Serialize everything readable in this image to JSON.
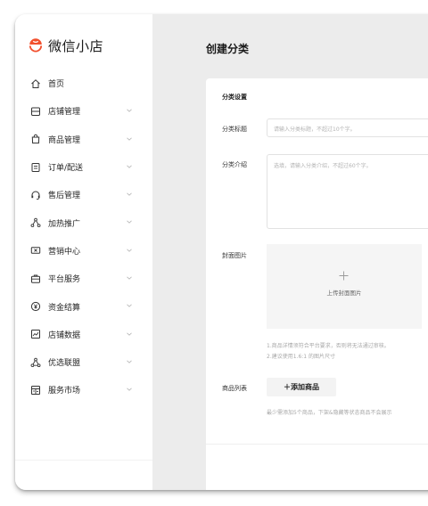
{
  "app": {
    "name": "微信小店",
    "brand_color": "#f2502e"
  },
  "sidebar": {
    "items": [
      {
        "label": "首页",
        "icon": "home-icon",
        "has_submenu": false
      },
      {
        "label": "店铺管理",
        "icon": "store-icon",
        "has_submenu": true
      },
      {
        "label": "商品管理",
        "icon": "shopping-bag-icon",
        "has_submenu": true
      },
      {
        "label": "订单/配送",
        "icon": "order-list-icon",
        "has_submenu": true
      },
      {
        "label": "售后管理",
        "icon": "headset-icon",
        "has_submenu": true
      },
      {
        "label": "加热推广",
        "icon": "share-nodes-icon",
        "has_submenu": true
      },
      {
        "label": "营销中心",
        "icon": "ticket-icon",
        "has_submenu": true
      },
      {
        "label": "平台服务",
        "icon": "briefcase-icon",
        "has_submenu": true
      },
      {
        "label": "资金结算",
        "icon": "yen-circle-icon",
        "has_submenu": true
      },
      {
        "label": "店铺数据",
        "icon": "chart-icon",
        "has_submenu": true
      },
      {
        "label": "优选联盟",
        "icon": "alliance-icon",
        "has_submenu": true
      },
      {
        "label": "服务市场",
        "icon": "market-icon",
        "has_submenu": true
      }
    ]
  },
  "page": {
    "title": "创建分类"
  },
  "form": {
    "section_title": "分类设置",
    "name_label": "分类标题",
    "name_placeholder": "请输入分类标题，不超过10个字。",
    "desc_label": "分类介绍",
    "desc_placeholder": "选填，请输入分类介绍，不超过60个字。",
    "cover_label": "封面图片",
    "cover_upload_text": "上传封面图片",
    "cover_tip_1": "1.商品详情须符合平台要求，否则将无法通过审核。",
    "cover_tip_2": "2.建议使用1.6:1 的图片尺寸",
    "products_label": "商品列表",
    "add_button_label": "＋添加商品",
    "products_tip": "最少需添加5个商品，下架&隐藏等状态商品不会展示"
  }
}
